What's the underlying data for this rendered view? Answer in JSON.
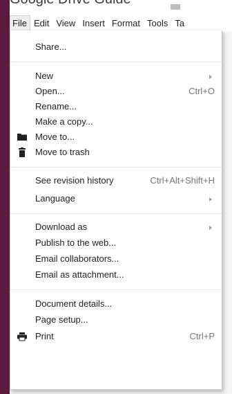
{
  "document": {
    "title": "Google Drive Guide"
  },
  "menubar": {
    "items": [
      "File",
      "Edit",
      "View",
      "Insert",
      "Format",
      "Tools",
      "Ta"
    ]
  },
  "file_menu": {
    "share": "Share...",
    "new": "New",
    "open": "Open...",
    "open_shortcut": "Ctrl+O",
    "rename": "Rename...",
    "make_copy": "Make a copy...",
    "move_to": "Move to...",
    "move_to_trash": "Move to trash",
    "revision_history": "See revision history",
    "revision_history_shortcut": "Ctrl+Alt+Shift+H",
    "language": "Language",
    "download_as": "Download as",
    "publish": "Publish to the web...",
    "email_collaborators": "Email collaborators...",
    "email_attachment": "Email as attachment...",
    "document_details": "Document details...",
    "page_setup": "Page setup...",
    "print": "Print",
    "print_shortcut": "Ctrl+P"
  },
  "icons": {
    "move_to": "folder-icon",
    "move_to_trash": "trash-icon",
    "print": "printer-icon",
    "submenu": "submenu-arrow-icon"
  },
  "colors": {
    "frame": "#5b1a3e"
  }
}
